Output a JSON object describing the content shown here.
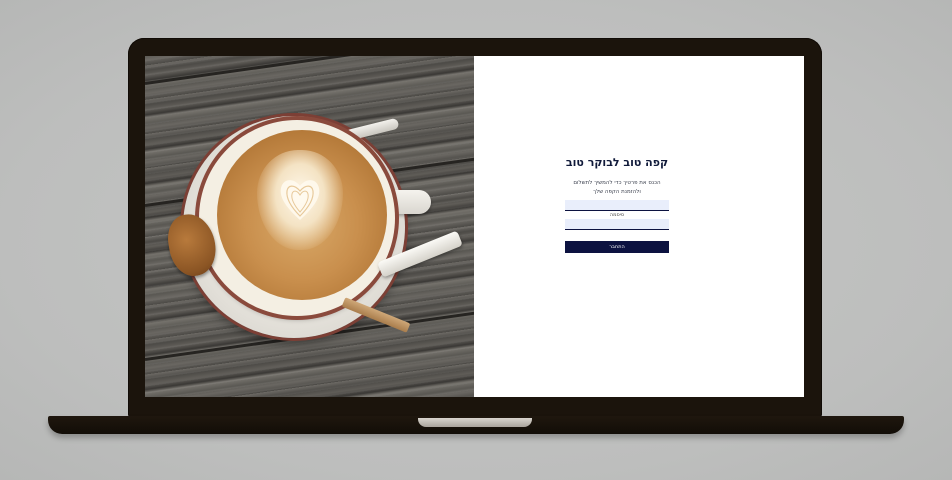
{
  "login": {
    "title": "קפה טוב לבוקר טוב",
    "description": "הכנס את פרטיך כדי להמשיך לתשלום ולהזמנת הקפה שלך",
    "email_placeholder": "",
    "email_value": "",
    "password_label": "סיסמה",
    "password_value": "",
    "submit_label": "התחבר"
  },
  "colors": {
    "accent": "#0c1240",
    "input_bg": "#e9eefb",
    "title": "#101a3a"
  },
  "image": {
    "icon": "coffee-cup-photo"
  }
}
